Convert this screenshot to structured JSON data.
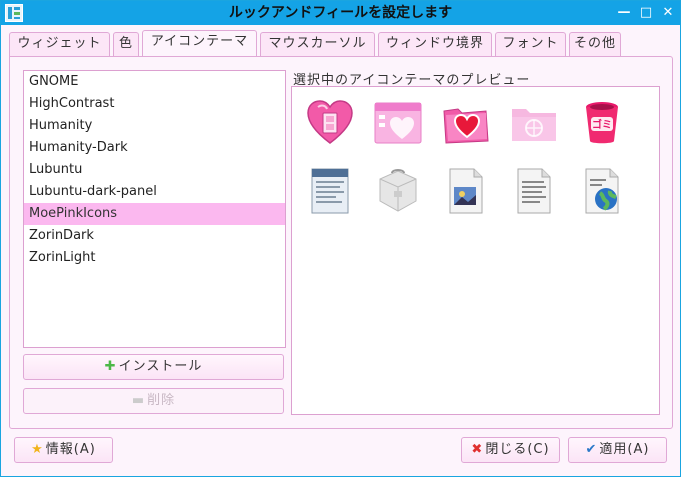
{
  "window": {
    "title": "ルックアンドフィールを設定します",
    "controls": {
      "minimize": "—",
      "maximize": "□",
      "close": "✕"
    }
  },
  "tabs": [
    {
      "label": "ウィジェット",
      "active": false
    },
    {
      "label": "色",
      "active": false
    },
    {
      "label": "アイコンテーマ",
      "active": true
    },
    {
      "label": "マウスカーソル",
      "active": false
    },
    {
      "label": "ウィンドウ境界",
      "active": false
    },
    {
      "label": "フォント",
      "active": false
    },
    {
      "label": "その他",
      "active": false
    }
  ],
  "themes": [
    {
      "name": "GNOME",
      "selected": false
    },
    {
      "name": "HighContrast",
      "selected": false
    },
    {
      "name": "Humanity",
      "selected": false
    },
    {
      "name": "Humanity-Dark",
      "selected": false
    },
    {
      "name": "Lubuntu",
      "selected": false
    },
    {
      "name": "Lubuntu-dark-panel",
      "selected": false
    },
    {
      "name": "MoePinkIcons",
      "selected": true
    },
    {
      "name": "ZorinDark",
      "selected": false
    },
    {
      "name": "ZorinLight",
      "selected": false
    }
  ],
  "buttons": {
    "install": "インストール",
    "remove": "削除",
    "about": "情報(A)",
    "close": "閉じる(C)",
    "apply": "適用(A)"
  },
  "preview": {
    "label": "選択中のアイコンテーマのプレビュー",
    "icons": [
      "heart-home-icon",
      "window-heart-icon",
      "folder-heart-icon",
      "folder-pink-icon",
      "trash-pink-icon",
      "text-document-icon",
      "package-icon",
      "image-document-icon",
      "text-file-icon",
      "web-document-icon"
    ]
  },
  "colors": {
    "titlebar": "#14a3e6",
    "selection": "#fbb8ef",
    "border": "#e0a8d6",
    "pink": "#f06ab0"
  }
}
